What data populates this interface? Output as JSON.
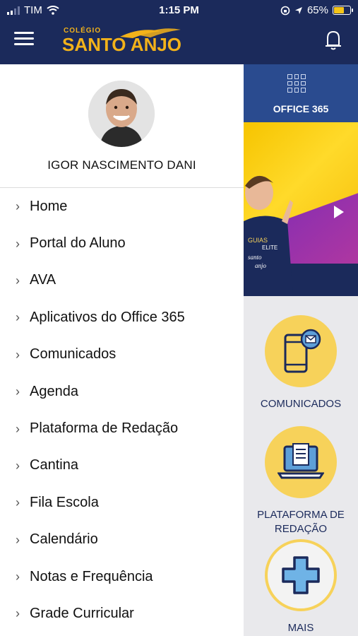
{
  "status_bar": {
    "carrier": "TIM",
    "time": "1:15 PM",
    "battery": "65%"
  },
  "header": {
    "logo_small": "COLÉGIO",
    "logo_main": "SANTO ANJO"
  },
  "drawer": {
    "user_name": "IGOR NASCIMENTO DANI",
    "menu": [
      {
        "label": "Home"
      },
      {
        "label": "Portal do Aluno"
      },
      {
        "label": "AVA"
      },
      {
        "label": "Aplicativos do Office 365"
      },
      {
        "label": "Comunicados"
      },
      {
        "label": "Agenda"
      },
      {
        "label": "Plataforma de Redação"
      },
      {
        "label": "Cantina"
      },
      {
        "label": "Fila Escola"
      },
      {
        "label": "Calendário"
      },
      {
        "label": "Notas e Frequência"
      },
      {
        "label": "Grade Curricular"
      }
    ]
  },
  "content": {
    "office_label": "OFFICE 365",
    "banner_text": [
      "GUIAS",
      "ELITE",
      "santo",
      "anjo"
    ],
    "tiles": [
      {
        "label": "COMUNICADOS"
      },
      {
        "label_line1": "PLATAFORMA DE",
        "label_line2": "REDAÇÃO"
      },
      {
        "label": "MAIS"
      }
    ]
  },
  "colors": {
    "navy": "#1b2a5b",
    "gold": "#f2b21a",
    "tile_yellow": "#f7d25a",
    "office_blue": "#2a4b8f"
  },
  "icons": {
    "menu": "hamburger-icon",
    "notifications": "bell-icon",
    "office": "app-grid-icon",
    "comunicados": "phone-message-icon",
    "redacao": "laptop-document-icon",
    "mais": "plus-cross-icon",
    "play": "play-icon"
  }
}
